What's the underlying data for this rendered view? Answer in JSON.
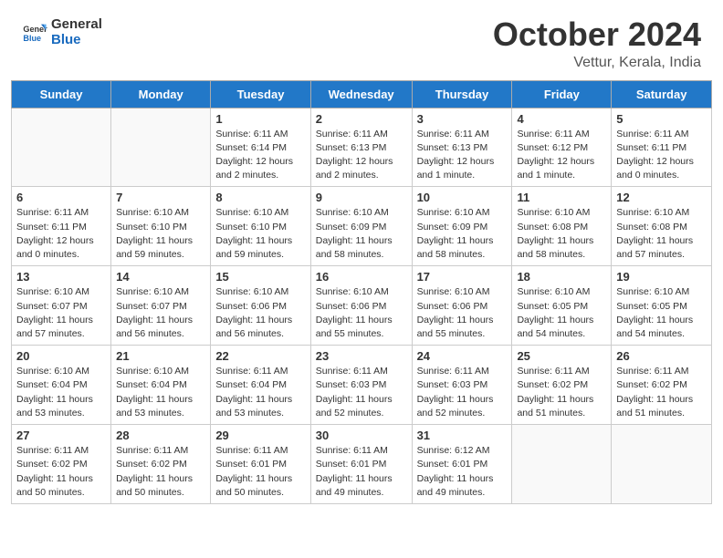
{
  "header": {
    "logo_line1": "General",
    "logo_line2": "Blue",
    "month": "October 2024",
    "location": "Vettur, Kerala, India"
  },
  "days_of_week": [
    "Sunday",
    "Monday",
    "Tuesday",
    "Wednesday",
    "Thursday",
    "Friday",
    "Saturday"
  ],
  "weeks": [
    [
      {
        "day": "",
        "info": ""
      },
      {
        "day": "",
        "info": ""
      },
      {
        "day": "1",
        "info": "Sunrise: 6:11 AM\nSunset: 6:14 PM\nDaylight: 12 hours and 2 minutes."
      },
      {
        "day": "2",
        "info": "Sunrise: 6:11 AM\nSunset: 6:13 PM\nDaylight: 12 hours and 2 minutes."
      },
      {
        "day": "3",
        "info": "Sunrise: 6:11 AM\nSunset: 6:13 PM\nDaylight: 12 hours and 1 minute."
      },
      {
        "day": "4",
        "info": "Sunrise: 6:11 AM\nSunset: 6:12 PM\nDaylight: 12 hours and 1 minute."
      },
      {
        "day": "5",
        "info": "Sunrise: 6:11 AM\nSunset: 6:11 PM\nDaylight: 12 hours and 0 minutes."
      }
    ],
    [
      {
        "day": "6",
        "info": "Sunrise: 6:11 AM\nSunset: 6:11 PM\nDaylight: 12 hours and 0 minutes."
      },
      {
        "day": "7",
        "info": "Sunrise: 6:10 AM\nSunset: 6:10 PM\nDaylight: 11 hours and 59 minutes."
      },
      {
        "day": "8",
        "info": "Sunrise: 6:10 AM\nSunset: 6:10 PM\nDaylight: 11 hours and 59 minutes."
      },
      {
        "day": "9",
        "info": "Sunrise: 6:10 AM\nSunset: 6:09 PM\nDaylight: 11 hours and 58 minutes."
      },
      {
        "day": "10",
        "info": "Sunrise: 6:10 AM\nSunset: 6:09 PM\nDaylight: 11 hours and 58 minutes."
      },
      {
        "day": "11",
        "info": "Sunrise: 6:10 AM\nSunset: 6:08 PM\nDaylight: 11 hours and 58 minutes."
      },
      {
        "day": "12",
        "info": "Sunrise: 6:10 AM\nSunset: 6:08 PM\nDaylight: 11 hours and 57 minutes."
      }
    ],
    [
      {
        "day": "13",
        "info": "Sunrise: 6:10 AM\nSunset: 6:07 PM\nDaylight: 11 hours and 57 minutes."
      },
      {
        "day": "14",
        "info": "Sunrise: 6:10 AM\nSunset: 6:07 PM\nDaylight: 11 hours and 56 minutes."
      },
      {
        "day": "15",
        "info": "Sunrise: 6:10 AM\nSunset: 6:06 PM\nDaylight: 11 hours and 56 minutes."
      },
      {
        "day": "16",
        "info": "Sunrise: 6:10 AM\nSunset: 6:06 PM\nDaylight: 11 hours and 55 minutes."
      },
      {
        "day": "17",
        "info": "Sunrise: 6:10 AM\nSunset: 6:06 PM\nDaylight: 11 hours and 55 minutes."
      },
      {
        "day": "18",
        "info": "Sunrise: 6:10 AM\nSunset: 6:05 PM\nDaylight: 11 hours and 54 minutes."
      },
      {
        "day": "19",
        "info": "Sunrise: 6:10 AM\nSunset: 6:05 PM\nDaylight: 11 hours and 54 minutes."
      }
    ],
    [
      {
        "day": "20",
        "info": "Sunrise: 6:10 AM\nSunset: 6:04 PM\nDaylight: 11 hours and 53 minutes."
      },
      {
        "day": "21",
        "info": "Sunrise: 6:10 AM\nSunset: 6:04 PM\nDaylight: 11 hours and 53 minutes."
      },
      {
        "day": "22",
        "info": "Sunrise: 6:11 AM\nSunset: 6:04 PM\nDaylight: 11 hours and 53 minutes."
      },
      {
        "day": "23",
        "info": "Sunrise: 6:11 AM\nSunset: 6:03 PM\nDaylight: 11 hours and 52 minutes."
      },
      {
        "day": "24",
        "info": "Sunrise: 6:11 AM\nSunset: 6:03 PM\nDaylight: 11 hours and 52 minutes."
      },
      {
        "day": "25",
        "info": "Sunrise: 6:11 AM\nSunset: 6:02 PM\nDaylight: 11 hours and 51 minutes."
      },
      {
        "day": "26",
        "info": "Sunrise: 6:11 AM\nSunset: 6:02 PM\nDaylight: 11 hours and 51 minutes."
      }
    ],
    [
      {
        "day": "27",
        "info": "Sunrise: 6:11 AM\nSunset: 6:02 PM\nDaylight: 11 hours and 50 minutes."
      },
      {
        "day": "28",
        "info": "Sunrise: 6:11 AM\nSunset: 6:02 PM\nDaylight: 11 hours and 50 minutes."
      },
      {
        "day": "29",
        "info": "Sunrise: 6:11 AM\nSunset: 6:01 PM\nDaylight: 11 hours and 50 minutes."
      },
      {
        "day": "30",
        "info": "Sunrise: 6:11 AM\nSunset: 6:01 PM\nDaylight: 11 hours and 49 minutes."
      },
      {
        "day": "31",
        "info": "Sunrise: 6:12 AM\nSunset: 6:01 PM\nDaylight: 11 hours and 49 minutes."
      },
      {
        "day": "",
        "info": ""
      },
      {
        "day": "",
        "info": ""
      }
    ]
  ]
}
